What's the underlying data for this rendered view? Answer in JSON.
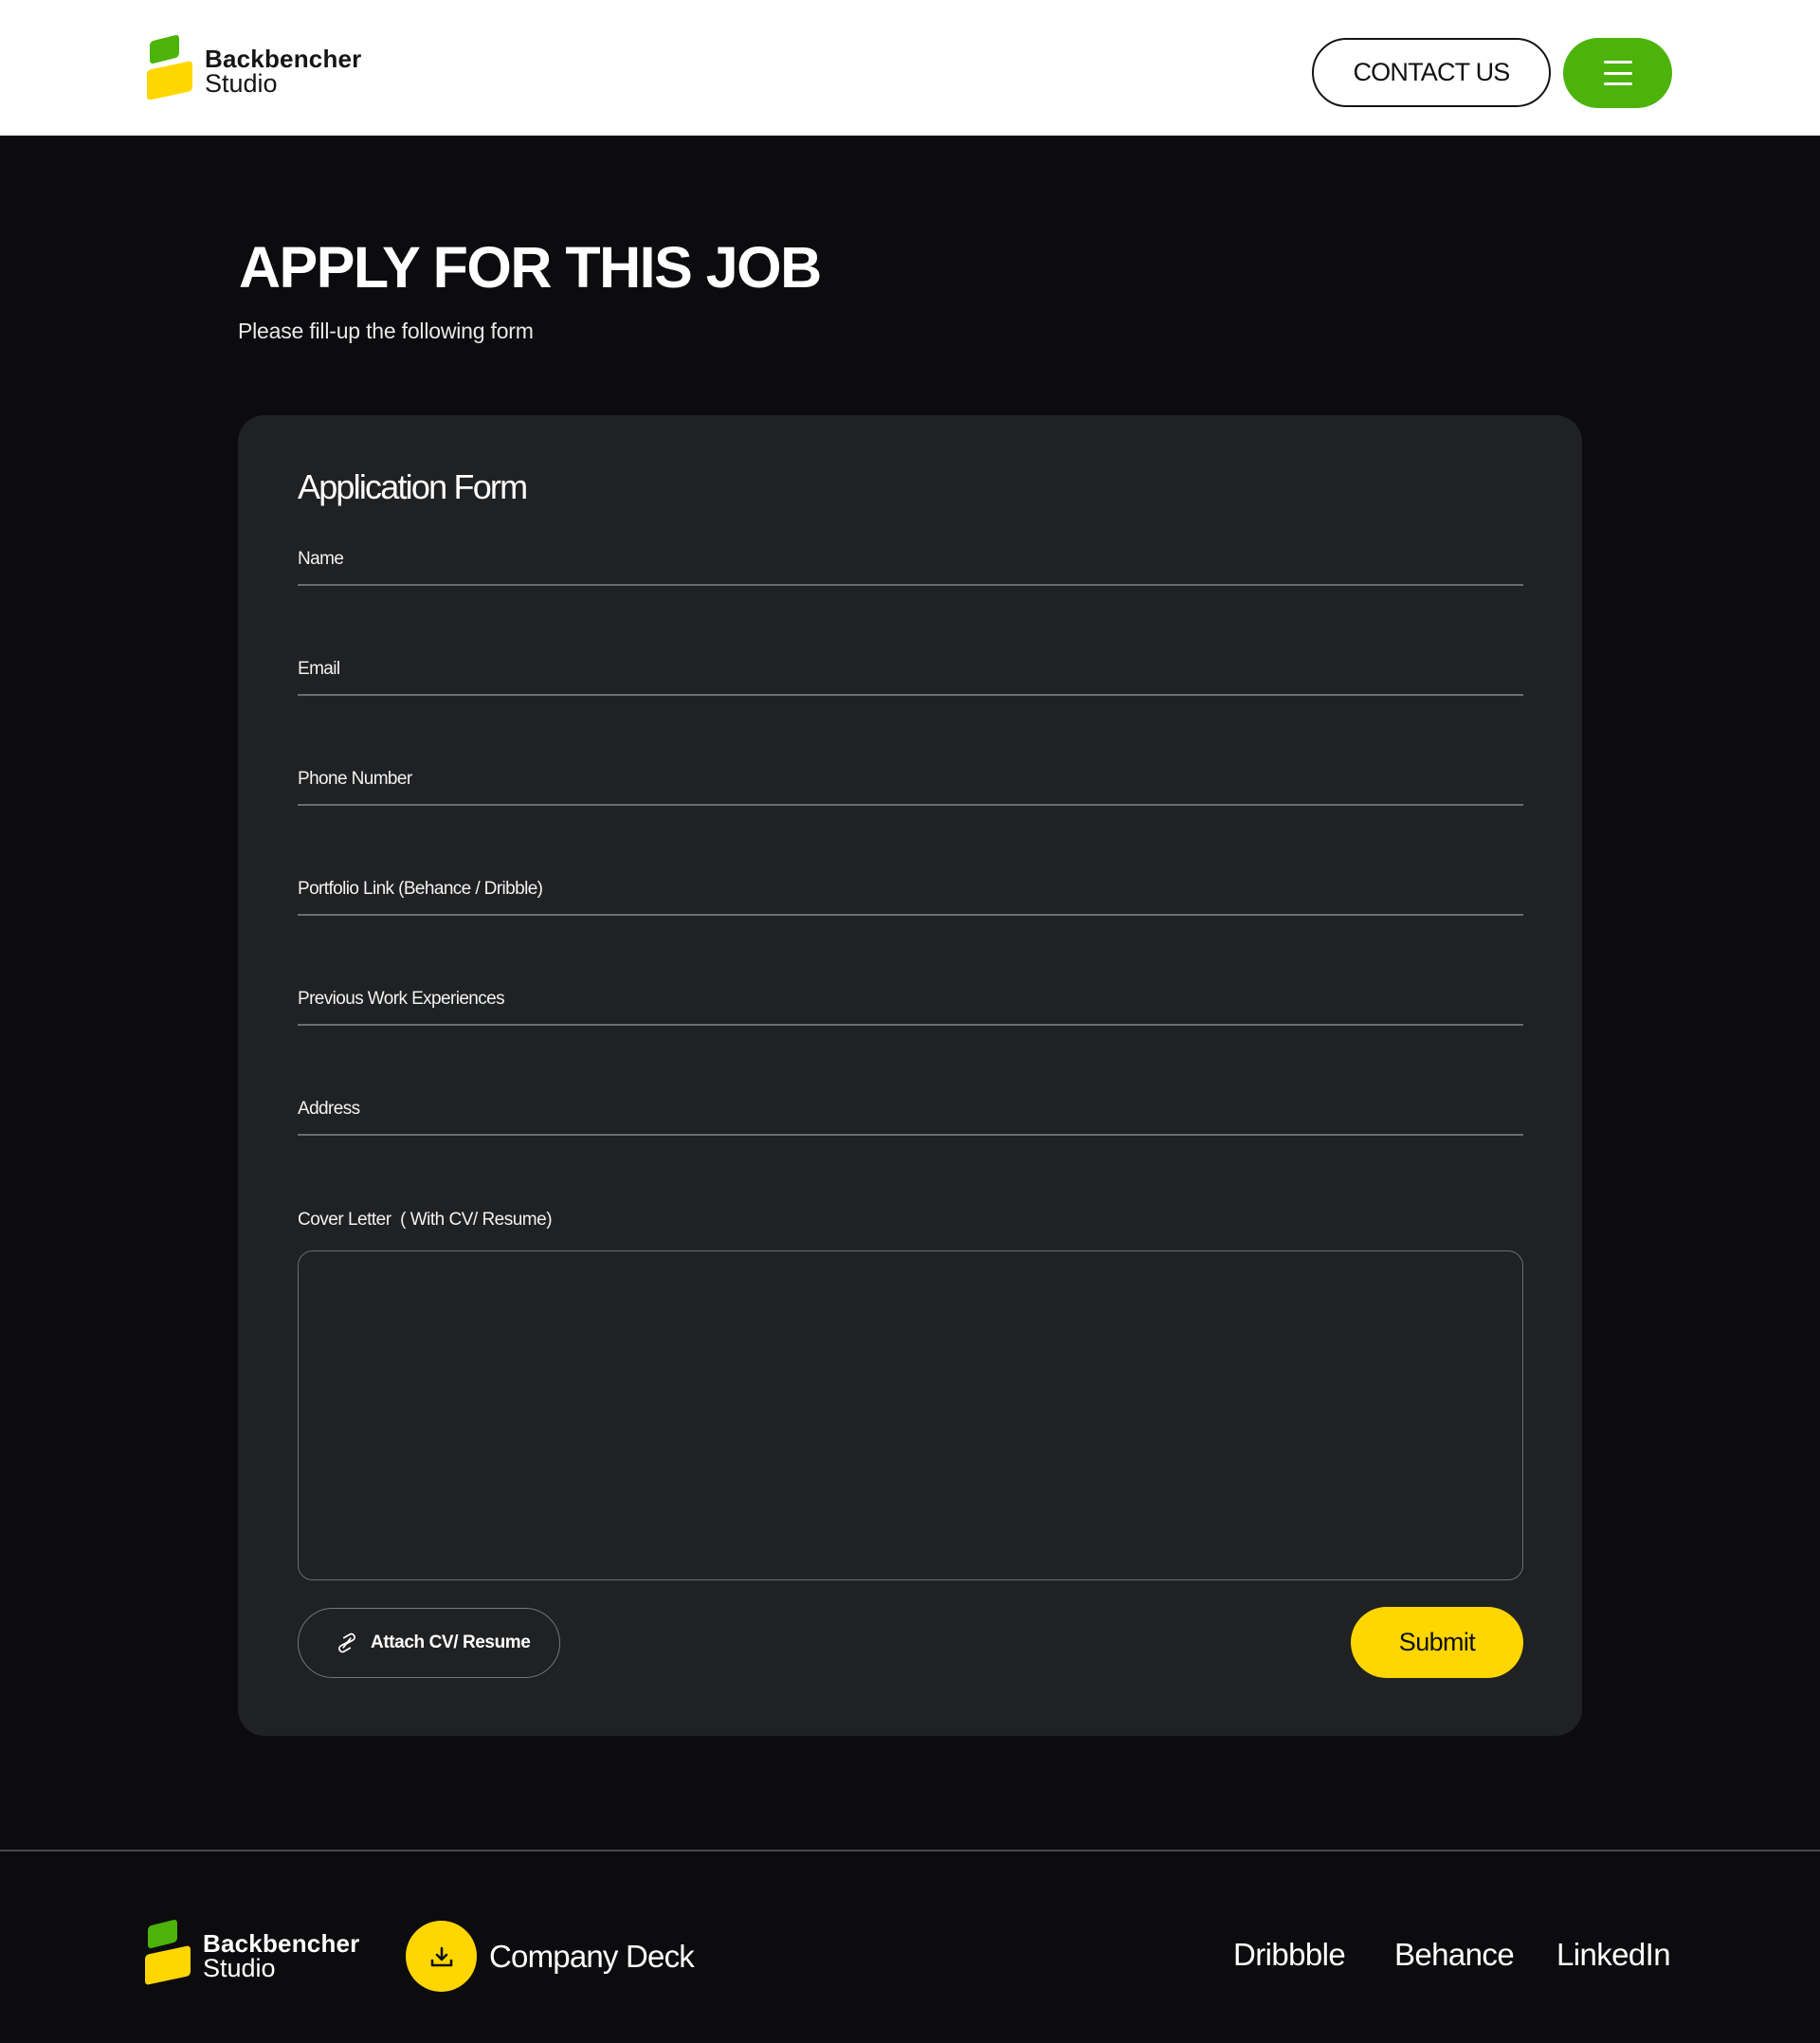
{
  "brand": {
    "line1": "Backbencher",
    "line2": "Studio",
    "colors": {
      "green": "#4cb30b",
      "yellow": "#ffd600"
    }
  },
  "header": {
    "contact_label": "CONTACT US",
    "menu_icon": "hamburger-menu-icon"
  },
  "page": {
    "title": "APPLY FOR THIS JOB",
    "subtitle": "Please fill-up the following form"
  },
  "form": {
    "title": "Application Form",
    "fields": [
      {
        "label": "Name",
        "value": ""
      },
      {
        "label": "Email",
        "value": ""
      },
      {
        "label": "Phone Number",
        "value": ""
      },
      {
        "label": "Portfolio Link (Behance / Dribble)",
        "value": ""
      },
      {
        "label": "Previous Work Experiences",
        "value": ""
      },
      {
        "label": "Address",
        "value": ""
      }
    ],
    "cover_letter_label": "Cover Letter  ( With CV/ Resume)",
    "cover_letter_value": "",
    "attach_label": "Attach CV/ Resume",
    "attach_icon": "paperclip-icon",
    "submit_label": "Submit"
  },
  "footer": {
    "deck_label": "Company Deck",
    "deck_icon": "download-icon",
    "links": [
      "Dribbble",
      "Behance",
      "LinkedIn"
    ]
  }
}
